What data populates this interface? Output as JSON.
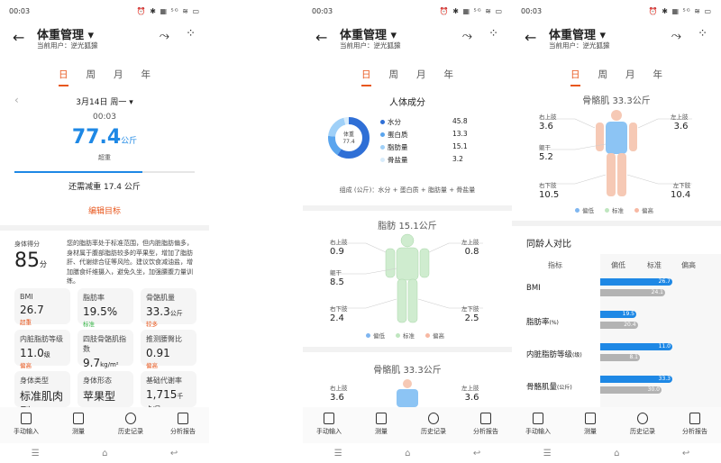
{
  "status": {
    "time": "00:03",
    "icons": "⏰ ✱ ▦ ⁵ᴳ ≋ ▭"
  },
  "header": {
    "title": "体重管理",
    "user": "当前用户：逆光狐獴"
  },
  "tabs": [
    "日",
    "周",
    "月",
    "年"
  ],
  "p1": {
    "date": "3月14日 周一",
    "time": "00:03",
    "weight": "77.4",
    "unit": "公斤",
    "status": "超重",
    "goal_text": "还需减重 17.4 公斤",
    "edit_goal": "编辑目标",
    "score_label": "身体得分",
    "score": "85",
    "score_unit": "分",
    "score_desc": "您的脂肪率处于标准范围，但内脏脂肪偏多，身材属于腹部脂肪较多的苹果型，增加了脂肪肝、代谢综合征等风险。建议饮食减油盐，增加膳食纤维摄入，避免久坐，加强腰腹力量训练。",
    "metrics": [
      {
        "label": "BMI",
        "value": "26.7",
        "unit": "",
        "status": "超重",
        "color": "#e8571d"
      },
      {
        "label": "脂肪率",
        "value": "19.5%",
        "unit": "",
        "status": "标准",
        "color": "#38b548"
      },
      {
        "label": "骨骼肌量",
        "value": "33.3",
        "unit": "公斤",
        "status": "较多",
        "color": "#e8571d"
      },
      {
        "label": "内脏脂肪等级",
        "value": "11.0",
        "unit": "级",
        "status": "偏高",
        "color": "#e8571d"
      },
      {
        "label": "四肢骨骼肌指数",
        "value": "9.7",
        "unit": "kg/m²",
        "status": "较高",
        "color": "#e8571d"
      },
      {
        "label": "推测腰臀比",
        "value": "0.91",
        "unit": "",
        "status": "偏高",
        "color": "#e8571d"
      },
      {
        "label": "身体类型",
        "value": "标准肌肉型",
        "unit": "",
        "status": "",
        "color": "#222"
      },
      {
        "label": "身体形态",
        "value": "苹果型",
        "unit": "",
        "status": "",
        "color": "#222"
      },
      {
        "label": "基础代谢率",
        "value": "1,715",
        "unit": "千卡/日",
        "status": "",
        "color": "#222"
      }
    ]
  },
  "p2": {
    "comp_title": "人体成分",
    "donut_label": "体重",
    "donut_value": "77.4",
    "comp": [
      {
        "name": "水分",
        "value": "45.8",
        "color": "#2f6fd6"
      },
      {
        "name": "蛋白质",
        "value": "13.3",
        "color": "#5aa5ee"
      },
      {
        "name": "脂肪量",
        "value": "15.1",
        "color": "#9fd0f8"
      },
      {
        "name": "骨盐量",
        "value": "3.2",
        "color": "#d8ecfb"
      }
    ],
    "formula": "组成 (公斤)：水分 + 蛋白质 + 脂肪量 + 骨盐量",
    "fat_title": "脂肪 15.1公斤",
    "fat": {
      "ul": "0.9",
      "ur": "0.8",
      "trunk": "8.5",
      "ll": "2.4",
      "lr": "2.5"
    },
    "legend": [
      "偏低",
      "标准",
      "偏高"
    ],
    "muscle_title": "骨骼肌 33.3公斤",
    "muscle": {
      "ul": "3.6",
      "ur": "3.6"
    }
  },
  "p3": {
    "muscle_title": "骨骼肌 33.3公斤",
    "muscle": {
      "ul": "3.6",
      "ur": "3.6",
      "trunk": "5.2",
      "ll": "10.5",
      "lr": "10.4"
    },
    "compare_title": "同龄人对比",
    "cols": [
      "指标",
      "偏低",
      "标准",
      "偏高"
    ],
    "rows": [
      {
        "name": "BMI",
        "unit": "",
        "mine": "26.7",
        "peer": "24.1",
        "mine_frac": 1.0,
        "peer_frac": 0.9
      },
      {
        "name": "脂肪率",
        "unit": "(%)",
        "mine": "19.5",
        "peer": "20.4",
        "mine_frac": 0.5,
        "peer_frac": 0.52
      },
      {
        "name": "内脏脂肪等级",
        "unit": "(级)",
        "mine": "11.0",
        "peer": "8.1",
        "mine_frac": 1.0,
        "peer_frac": 0.55
      },
      {
        "name": "骨骼肌量",
        "unit": "(公斤)",
        "mine": "33.3",
        "peer": "30.0",
        "mine_frac": 1.0,
        "peer_frac": 0.85
      }
    ]
  },
  "labels": {
    "ul": "右上肢",
    "ur": "左上肢",
    "trunk": "躯干",
    "ll": "右下肢",
    "lr": "左下肢"
  },
  "nav": [
    "手动输入",
    "测量",
    "历史记录",
    "分析报告"
  ]
}
